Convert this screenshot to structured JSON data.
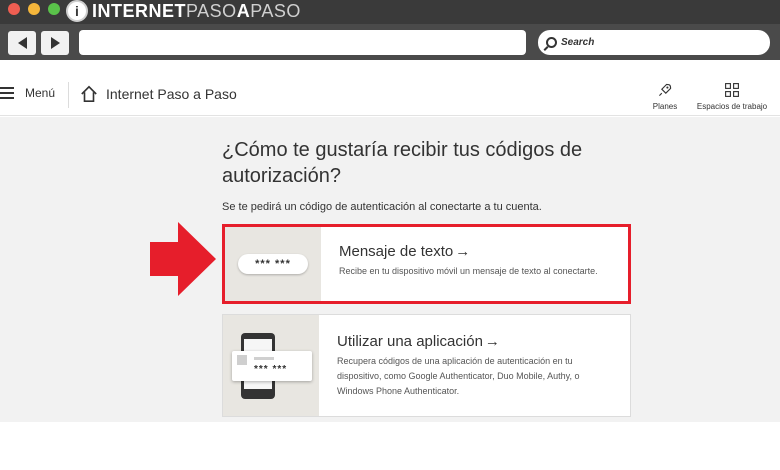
{
  "brand": {
    "mark": "i",
    "part1": "INTERNET",
    "part2": "PASO",
    "part3": "A",
    "part4": "PASO"
  },
  "browser": {
    "search_placeholder": "Search"
  },
  "header": {
    "menu_label": "Menú",
    "site_name": "Internet Paso a Paso",
    "actions": [
      {
        "label": "Planes",
        "icon": "rocket-icon"
      },
      {
        "label": "Espacios de trabajo",
        "icon": "grid-icon"
      }
    ]
  },
  "main": {
    "title": "¿Cómo te gustaría recibir tus códigos de autorización?",
    "subtitle": "Se te pedirá un código de autenticación al conectarte a tu cuenta.",
    "options": [
      {
        "title": "Mensaje de texto",
        "arrow": "→",
        "description": "Recibe en tu dispositivo móvil un mensaje de texto al conectarte.",
        "illustration_code": "*** ***",
        "highlighted": true
      },
      {
        "title": "Utilizar una aplicación",
        "arrow": "→",
        "description": "Recupera códigos de una aplicación de autenticación en tu dispositivo, como Google Authenticator, Duo Mobile, Authy, o Windows Phone Authenticator.",
        "illustration_code": "*** ***",
        "highlighted": false
      }
    ]
  },
  "colors": {
    "highlight": "#e61e2b",
    "arrow": "#e61e2b",
    "chrome": "#4a4a4a",
    "background": "#f2f2f2"
  }
}
